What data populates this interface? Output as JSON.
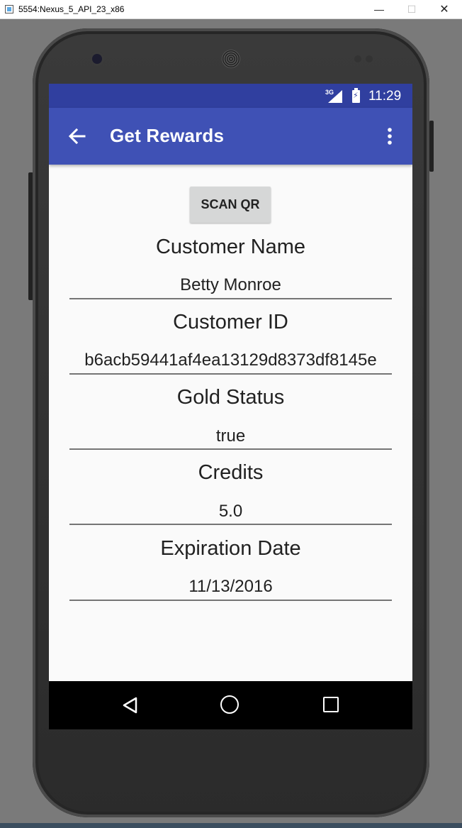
{
  "window": {
    "title": "5554:Nexus_5_API_23_x86",
    "minimize_glyph": "—",
    "maximize_glyph": "☐",
    "close_glyph": "✕"
  },
  "status_bar": {
    "network": "3G",
    "time": "11:29"
  },
  "app_bar": {
    "title": "Get Rewards"
  },
  "scan_button": {
    "label": "SCAN QR"
  },
  "fields": [
    {
      "label": "Customer Name",
      "value": "Betty Monroe"
    },
    {
      "label": "Customer ID",
      "value": "b6acb59441af4ea13129d8373df8145e"
    },
    {
      "label": "Gold Status",
      "value": "true"
    },
    {
      "label": "Credits",
      "value": "5.0"
    },
    {
      "label": "Expiration Date",
      "value": "11/13/2016"
    }
  ],
  "colors": {
    "status_bar": "#303f9f",
    "app_bar": "#3f51b5",
    "screen_background": "#fafafa",
    "button": "#d6d7d7"
  },
  "icons": {
    "back": "arrow-left-icon",
    "overflow": "more-vert-icon",
    "nav_back": "triangle-back-icon",
    "nav_home": "circle-home-icon",
    "nav_recents": "square-recents-icon"
  }
}
